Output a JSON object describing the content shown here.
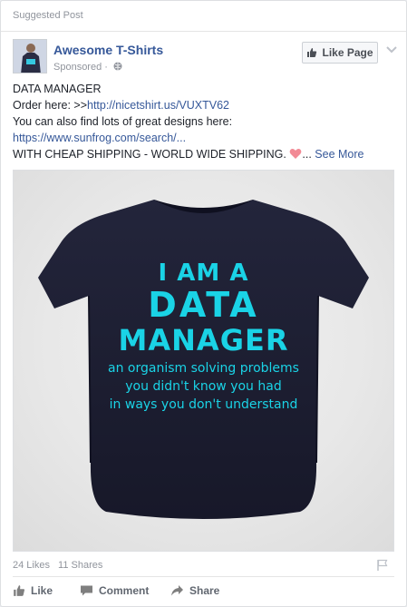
{
  "suggested_label": "Suggested Post",
  "page": {
    "name": "Awesome T-Shirts",
    "sponsored": "Sponsored",
    "like_page_label": "Like Page"
  },
  "post": {
    "line1": "DATA MANAGER",
    "order_prefix": "Order here: >>",
    "order_link": "http://nicetshirt.us/VUXTV62",
    "line3": "You can also find lots of great designs here:",
    "sunfrog_link": "https://www.sunfrog.com/search/...",
    "line5": "WITH CHEAP SHIPPING - WORLD WIDE SHIPPING.",
    "ellipsis": "...",
    "see_more": "See More"
  },
  "shirt": {
    "line1": "I AM A",
    "line2": "DATA",
    "line3": "MANAGER",
    "line4": "an organism solving problems",
    "line5": "you didn't know you had",
    "line6": "in ways you don't understand",
    "shirt_color": "#1e1f33",
    "text_color": "#1ad3e6"
  },
  "stats": {
    "likes": "24 Likes",
    "shares": "11 Shares"
  },
  "actions": {
    "like": "Like",
    "comment": "Comment",
    "share": "Share"
  },
  "colors": {
    "link": "#365899",
    "muted": "#90949c",
    "heart": "#f25268"
  },
  "icons": [
    "avatar-shirt",
    "globe-icon",
    "thumbs-up-icon",
    "chevron-down-icon",
    "heart-icon",
    "flag-icon",
    "like-icon",
    "comment-icon",
    "share-icon"
  ]
}
